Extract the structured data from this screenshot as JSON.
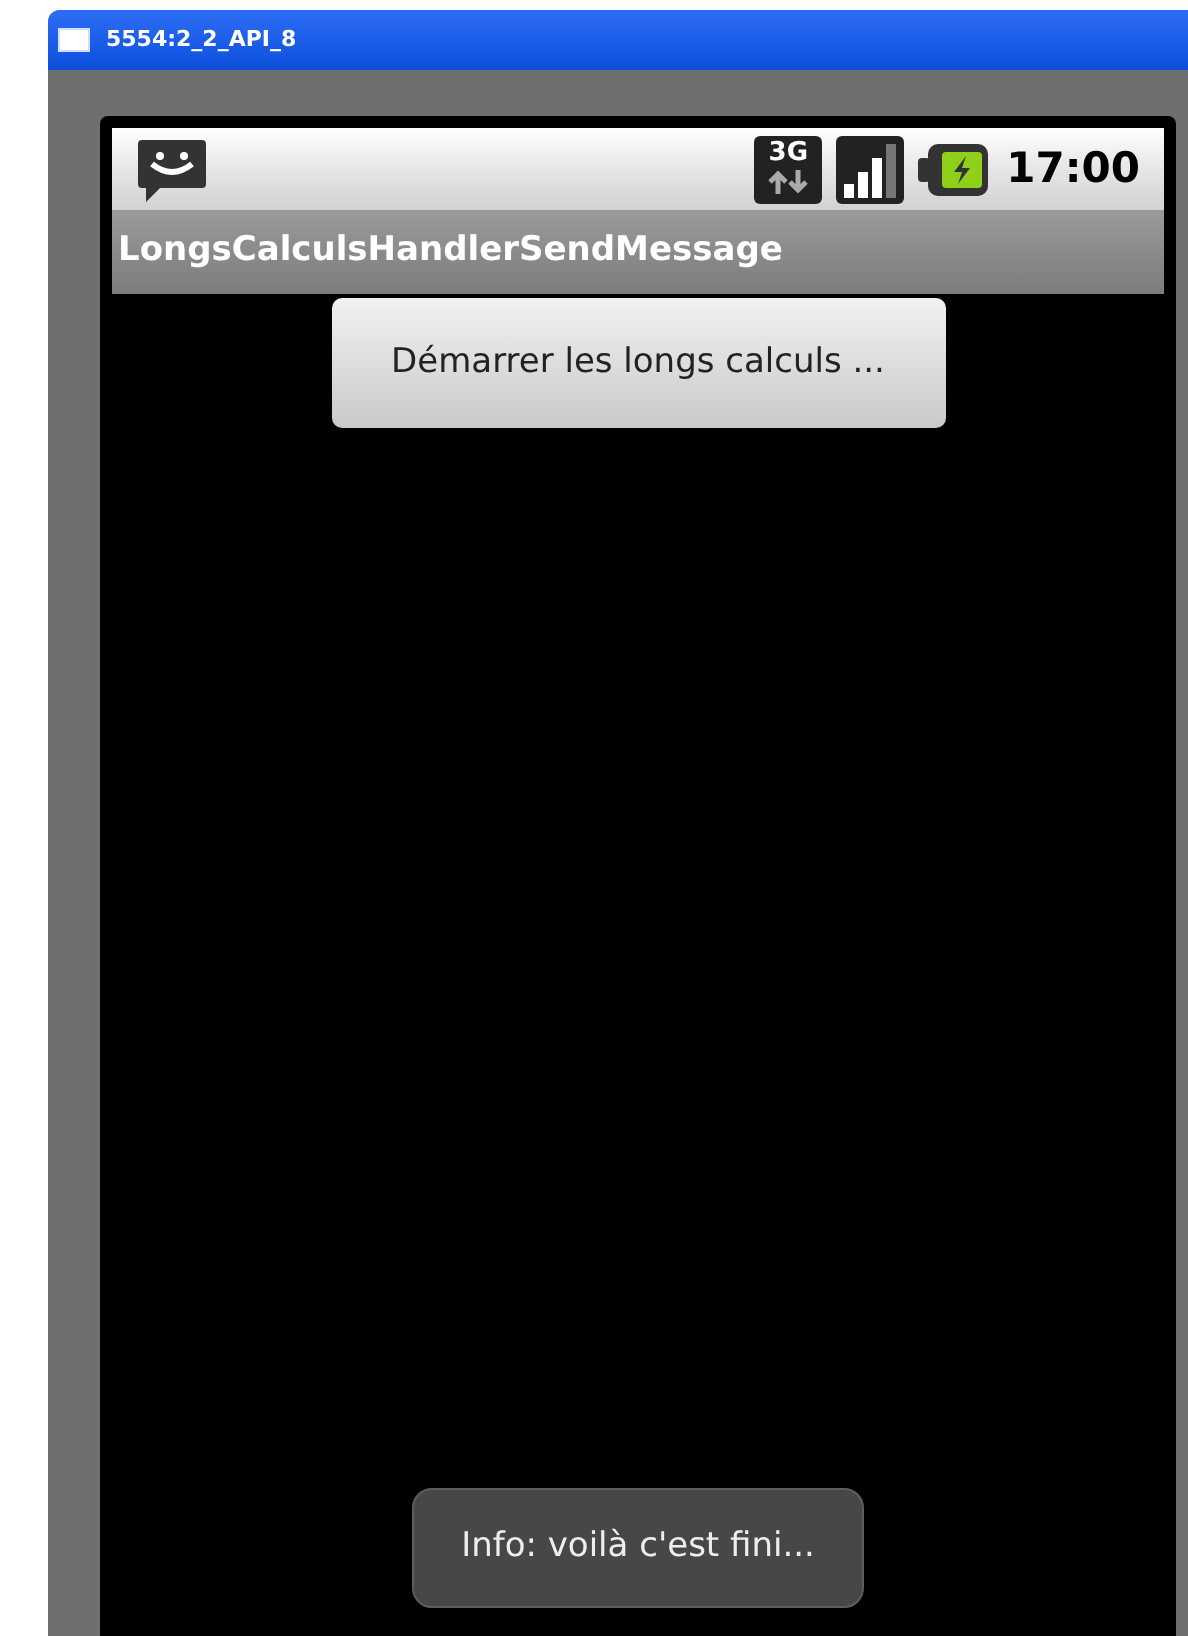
{
  "window": {
    "title": "5554:2_2_API_8"
  },
  "status_bar": {
    "network_type": "3G",
    "time": "17:00"
  },
  "app_bar": {
    "title": "LongsCalculsHandlerSendMessage"
  },
  "button": {
    "label": "Démarrer les longs calculs ..."
  },
  "toast": {
    "text": "Info: voilà c'est fini..."
  }
}
